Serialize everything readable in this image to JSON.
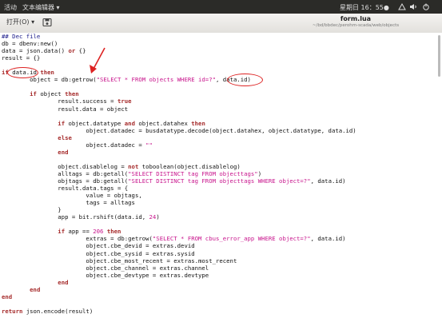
{
  "topbar": {
    "activities": "活动",
    "app_menu": "文本编辑器 ▾",
    "clock": "星期日 16：55●",
    "icons": [
      "network-icon",
      "volume-icon",
      "power-icon"
    ]
  },
  "toolbar": {
    "open_label": "打开(O) ▾",
    "save_icon": "save-icon"
  },
  "window": {
    "title": "form.lua",
    "path": "~/bd/bbdec/perohm-scada/web/objects"
  },
  "annotation": {
    "color": "#dd2222"
  },
  "code": [
    "## Dec file",
    "db = dbenv:new()",
    "data = json.data() or {}",
    "result = {}",
    "",
    "if data.id then",
    "        object = db:getrow(\"SELECT * FROM objects WHERE id=?\", data.id)",
    "",
    "        if object then",
    "                result.success = true",
    "                result.data = object",
    "",
    "                if object.datatype and object.datahex then",
    "                        object.datadec = busdatatype.decode(object.datahex, object.datatype, data.id)",
    "                else",
    "                        object.datadec = \"\"",
    "                end",
    "",
    "                object.disablelog = not toboolean(object.disablelog)",
    "                alltags = db:getall(\"SELECT DISTINCT tag FROM objecttags\")",
    "                objtags = db:getall(\"SELECT DISTINCT tag FROM objecttags WHERE object=?\", data.id)",
    "                result.data.tags = {",
    "                        value = objtags,",
    "                        tags = alltags",
    "                }",
    "                app = bit.rshift(data.id, 24)",
    "",
    "                if app == 206 then",
    "                        extras = db:getrow(\"SELECT * FROM cbus_error_app WHERE object=?\", data.id)",
    "                        object.cbe_devid = extras.devid",
    "                        object.cbe_sysid = extras.sysid",
    "                        object.cbe_most_recent = extras.most_recent",
    "                        object.cbe_channel = extras.channel",
    "                        object.cbe_devtype = extras.devtype",
    "                end",
    "        end",
    "end",
    "",
    "return json.encode(result)"
  ]
}
